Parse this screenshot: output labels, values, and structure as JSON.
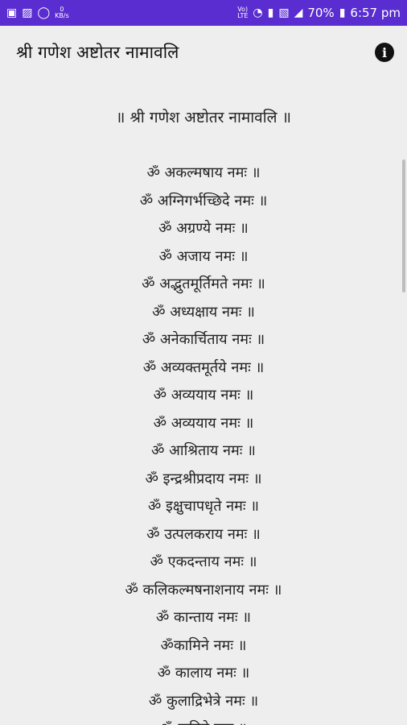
{
  "status_bar": {
    "net_speed_value": "0",
    "net_speed_unit": "KB/s",
    "lte_label": "LTE",
    "battery": "70%",
    "time": "6:57 pm",
    "icons": [
      "notification-icon",
      "gallery-icon",
      "whatsapp-icon",
      "volte-icon",
      "wifi-icon",
      "data-icon",
      "signal-icon",
      "battery-icon"
    ]
  },
  "app_bar": {
    "title": "श्री गणेश अष्टोतर नामावलि",
    "info_icon": "info-icon"
  },
  "content": {
    "heading": "॥ श्री गणेश अष्टोतर नामावलि ॥",
    "items": [
      "ॐ अकल्मषाय नमः ॥",
      "ॐ अग्निगर्भच्छिदे नमः ॥",
      "ॐ अग्रण्ये नमः ॥",
      "ॐ अजाय नमः ॥",
      "ॐ अद्भुतमूर्तिमते नमः ॥",
      "ॐ अध्यक्षाय नमः ॥",
      "ॐ अनेकार्चिताय नमः ॥",
      "ॐ अव्यक्तमूर्तये नमः ॥",
      "ॐ अव्ययाय नमः ॥",
      "ॐ अव्ययाय नमः ॥",
      "ॐ आश्रिताय नमः ॥",
      "ॐ इन्द्रश्रीप्रदाय नमः ॥",
      "ॐ इक्षुचापधृते नमः ॥",
      "ॐ उत्पलकराय नमः ॥",
      "ॐ एकदन्ताय नमः ॥",
      "ॐ कलिकल्मषनाशनाय नमः ॥",
      "ॐ कान्ताय नमः ॥",
      "ॐकामिने नमः ॥",
      "ॐ कालाय नमः ॥",
      "ॐ कुलाद्रिभेत्रे नमः ॥",
      "ॐ कृतिने नमः ॥"
    ]
  }
}
